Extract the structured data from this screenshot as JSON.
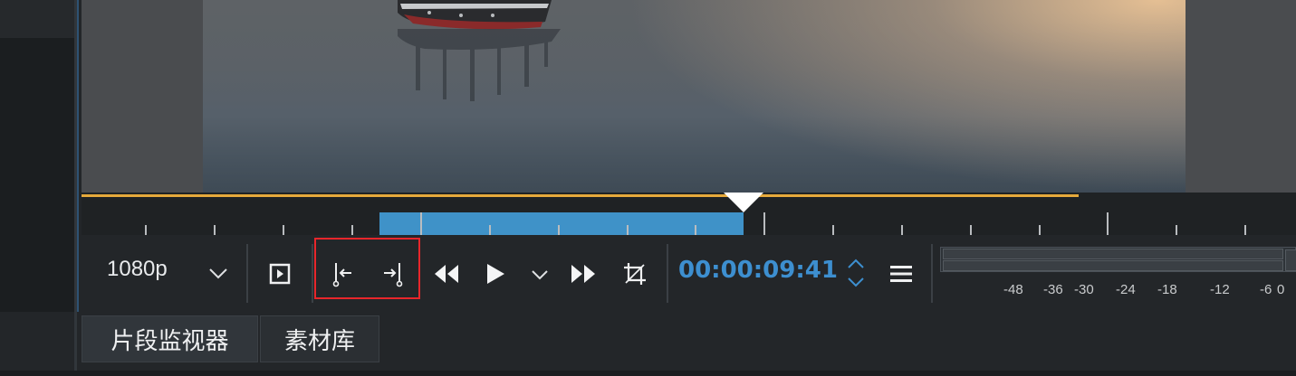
{
  "monitor": {
    "resolution_label": "1080p",
    "timecode": "00:00:09:41"
  },
  "audio_meter": {
    "scale_labels": [
      "-48",
      "-36",
      "-30",
      "-24",
      "-18",
      "-12",
      "-6",
      "0"
    ]
  },
  "tabs": [
    {
      "label": "片段监视器",
      "active": true
    },
    {
      "label": "素材库",
      "active": false
    }
  ],
  "colors": {
    "accent_blue": "#3d8fd0",
    "zone_blue": "#3f92c8",
    "ruler_orange": "#e5a93b",
    "highlight_red": "#e8262b",
    "background": "#232629"
  },
  "icons": {
    "resolution_dropdown": "chevron-down-icon",
    "zone_to_clip": "insert-zone-icon",
    "set_zone_in": "zone-in-icon",
    "set_zone_out": "zone-out-icon",
    "rewind": "rewind-icon",
    "play": "play-icon",
    "play_menu": "chevron-down-icon",
    "forward": "fast-forward-icon",
    "crop": "crop-icon",
    "timecode_spin": "spin-up-down-icon",
    "menu": "hamburger-menu-icon"
  }
}
